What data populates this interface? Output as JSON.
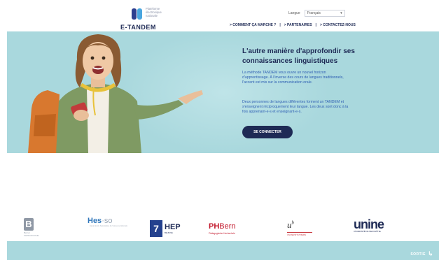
{
  "logo": {
    "subtitle_lines": [
      "Plateforme",
      "électronique",
      "nationale"
    ],
    "name": "E-TANDEM"
  },
  "language": {
    "label": "Langue",
    "selected": "Français"
  },
  "nav": {
    "items": [
      "> COMMENT ÇA MARCHE ?",
      "> PARTENAIRES",
      "> CONTACTEZ-NOUS"
    ],
    "separator": "|"
  },
  "hero": {
    "title": "L'autre manière d'approfondir ses connaissances linguistiques",
    "paragraph1": "La méthode TANDEM vous ouvre un nouvel horizon d'apprentissage. À l'inverse des cours de langues traditionnels, l'accent est mis sur la communication orale.",
    "paragraph2": "Deux personnes de langues différentes forment un TANDEM et s'enseignent réciproquement leur langue. Les deux sont donc à la fois apprenant-e-s et enseignant-e-s.",
    "cta": "SE CONNECTER"
  },
  "partners": {
    "bfh": {
      "mark": "B",
      "caption": "Berner Fachhochschule"
    },
    "hes": {
      "name_main": "Hes",
      "name_suffix": "·so",
      "caption": "Haute Ecole Spécialisée de Suisse occidentale"
    },
    "hep": {
      "mark": "7",
      "name": "HEP",
      "caption": "BEJUNE"
    },
    "ph": {
      "name_bold": "PH",
      "name_rest": "Bern",
      "caption": "Pädagogische Hochschule"
    },
    "ub": {
      "name": "u",
      "sup": "b",
      "caption": "UNIVERSITÄT BERN"
    },
    "unine": {
      "name": "unine",
      "caption": "UNIVERSITÉ DE NEUCHÂTEL"
    }
  },
  "footer": {
    "label": "SORTIE"
  },
  "colors": {
    "navy": "#1e2a55",
    "hero_bg": "#a9d8dd",
    "link_blue": "#2f5fb3",
    "button": "#1e2a55"
  }
}
